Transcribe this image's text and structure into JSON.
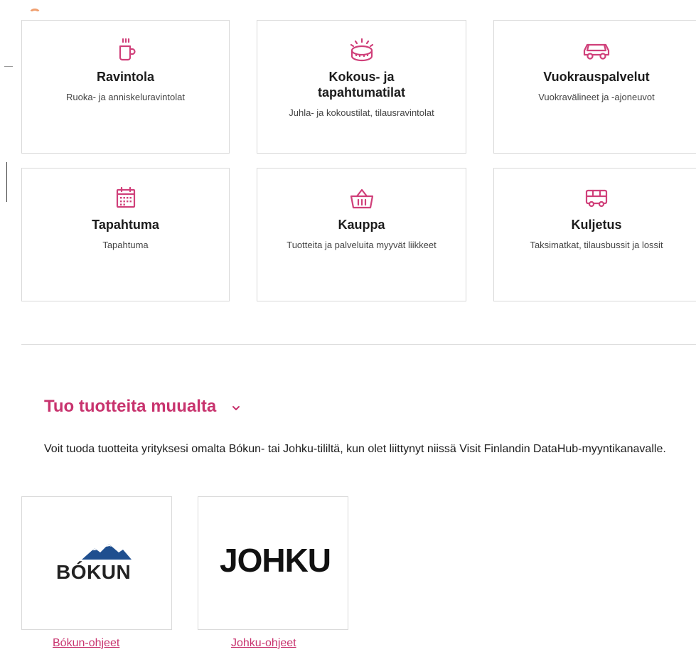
{
  "categories": [
    {
      "title": "Ravintola",
      "description": "Ruoka- ja anniskeluravintolat",
      "icon": "coffee-cup-icon"
    },
    {
      "title": "Kokous- ja tapahtumatilat",
      "description": "Juhla- ja kokoustilat, tilausravintolat",
      "icon": "arena-icon"
    },
    {
      "title": "Vuokrauspalvelut",
      "description": "Vuokravälineet ja -ajoneuvot",
      "icon": "car-icon"
    },
    {
      "title": "Tapahtuma",
      "description": "Tapahtuma",
      "icon": "calendar-icon"
    },
    {
      "title": "Kauppa",
      "description": "Tuotteita ja palveluita myyvät liikkeet",
      "icon": "basket-icon"
    },
    {
      "title": "Kuljetus",
      "description": "Taksimatkat, tilausbussit ja lossit",
      "icon": "bus-icon"
    }
  ],
  "import_section": {
    "heading": "Tuo tuotteita muualta",
    "text": "Voit tuoda tuotteita yrityksesi omalta Bókun- tai Johku-tililtä, kun olet liittynyt niissä Visit Finlandin DataHub-myyntikanavalle.",
    "providers": [
      {
        "logo_text": "BÓKUN",
        "link": "Bókun-ohjeet"
      },
      {
        "logo_text": "JOHKU",
        "link": "Johku-ohjeet"
      }
    ]
  },
  "colors": {
    "accent": "#c8336e",
    "icon": "#d0407a",
    "border": "#d9d9d9",
    "bokun_mountain": "#1f4f8f"
  }
}
